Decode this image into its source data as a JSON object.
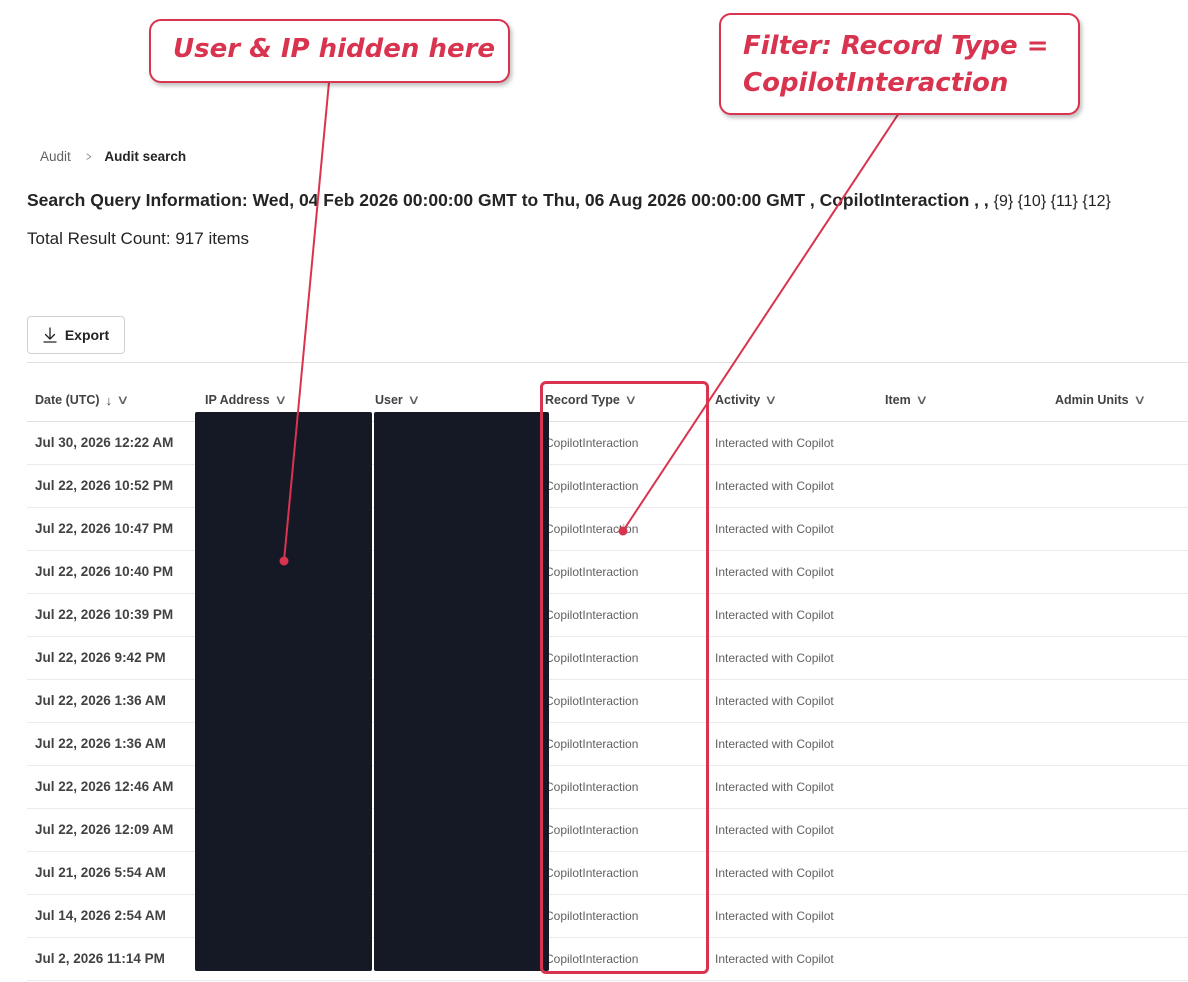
{
  "breadcrumb": {
    "parent": "Audit",
    "separator": ">",
    "current": "Audit search"
  },
  "query": {
    "text": "Search Query Information: Wed, 04 Feb 2026 00:00:00 GMT to Thu, 06 Aug 2026 00:00:00 GMT , CopilotInteraction , , ",
    "tail": "{9} {10} {11} {12}"
  },
  "result_count": "Total Result Count: 917 items",
  "toolbar": {
    "export_label": "Export",
    "export_icon": "download-arrow-icon"
  },
  "columns": {
    "date": "Date (UTC)",
    "ip": "IP Address",
    "user": "User",
    "record_type": "Record Type",
    "activity": "Activity",
    "item": "Item",
    "admin_units": "Admin Units"
  },
  "rows": [
    {
      "date": "Jul 30, 2026 12:22 AM",
      "record_type": "CopilotInteraction",
      "activity": "Interacted with Copilot"
    },
    {
      "date": "Jul 22, 2026 10:52 PM",
      "record_type": "CopilotInteraction",
      "activity": "Interacted with Copilot"
    },
    {
      "date": "Jul 22, 2026 10:47 PM",
      "record_type": "CopilotInteraction",
      "activity": "Interacted with Copilot"
    },
    {
      "date": "Jul 22, 2026 10:40 PM",
      "record_type": "CopilotInteraction",
      "activity": "Interacted with Copilot"
    },
    {
      "date": "Jul 22, 2026 10:39 PM",
      "record_type": "CopilotInteraction",
      "activity": "Interacted with Copilot"
    },
    {
      "date": "Jul 22, 2026 9:42 PM",
      "record_type": "CopilotInteraction",
      "activity": "Interacted with Copilot"
    },
    {
      "date": "Jul 22, 2026 1:36 AM",
      "record_type": "CopilotInteraction",
      "activity": "Interacted with Copilot"
    },
    {
      "date": "Jul 22, 2026 1:36 AM",
      "record_type": "CopilotInteraction",
      "activity": "Interacted with Copilot"
    },
    {
      "date": "Jul 22, 2026 12:46 AM",
      "record_type": "CopilotInteraction",
      "activity": "Interacted with Copilot"
    },
    {
      "date": "Jul 22, 2026 12:09 AM",
      "record_type": "CopilotInteraction",
      "activity": "Interacted with Copilot"
    },
    {
      "date": "Jul 21, 2026 5:54 AM",
      "record_type": "CopilotInteraction",
      "activity": "Interacted with Copilot"
    },
    {
      "date": "Jul 14, 2026 2:54 AM",
      "record_type": "CopilotInteraction",
      "activity": "Interacted with Copilot"
    },
    {
      "date": "Jul 2, 2026 11:14 PM",
      "record_type": "CopilotInteraction",
      "activity": "Interacted with Copilot"
    }
  ],
  "annotations": {
    "left": "User & IP hidden here",
    "right_line1": "Filter: Record Type =",
    "right_line2": "CopilotInteraction",
    "color": "#d9344f"
  },
  "redaction_color": "#141925"
}
